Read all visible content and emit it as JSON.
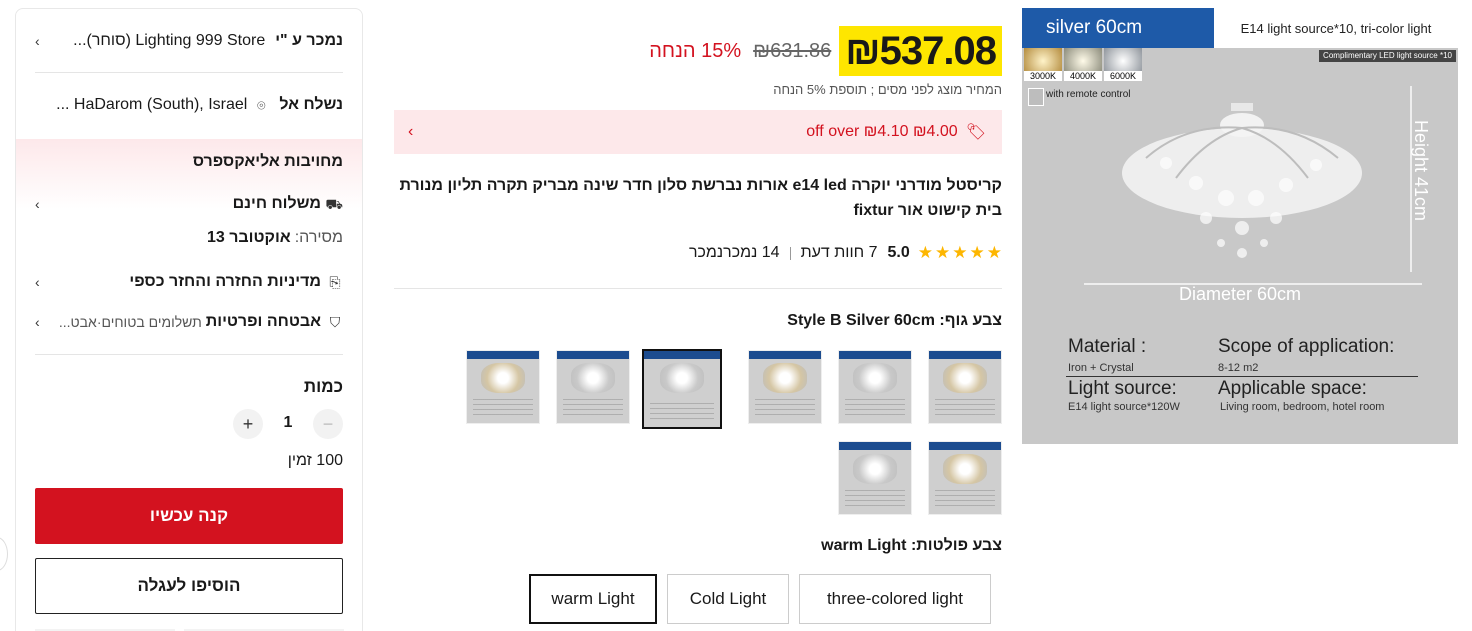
{
  "sidebar": {
    "sold_by_label": "נמכר ע \"י",
    "sold_by_store": "Lighting 999 Store (סוחר)...",
    "ship_to_label": "נשלח אל",
    "ship_to_value": "HaDarom (South), Israel ...",
    "commitment_title": "מחויבות אליאקספרס",
    "free_shipping": "משלוח חינם",
    "delivery_label": "מסירה:",
    "delivery_date": "אוקטובר 13",
    "returns": "מדיניות החזרה והחזר כספי",
    "security_label": "אבטחה ופרטיות",
    "security_detail": "תשלומים בטוחים·אבט...",
    "quantity_label": "כמות",
    "quantity_value": "1",
    "stock": "100 זמין",
    "buy_now": "קנה עכשיו",
    "add_to_cart": "הוסיפו לעגלה"
  },
  "price": {
    "current": "₪537.08",
    "original": "₪631.86",
    "discount": "15% הנחה",
    "tax_note": "המחיר מוצג לפני מסים ; תוספת 5% הנחה"
  },
  "coupon": {
    "text": "₪4.00 off over ₪4.10"
  },
  "product": {
    "title": "קריסטל מודרני יוקרה e14 led אורות נברשת סלון חדר שינה מבריק תקרה תליון מנורת בית קישוט אור fixtur",
    "rating": "5.0",
    "reviews": "7 חוות דעת",
    "sold": "14 נמכרנמכר"
  },
  "options": {
    "body_color_label": "צבע גוף:",
    "body_color_value": "Style B Silver 60cm",
    "bulb_color_label": "צבע פולטות:",
    "bulb_color_value": "warm Light",
    "bulb_choices": [
      "warm Light",
      "Cold Light",
      "three-colored light"
    ]
  },
  "image": {
    "header_left": "silver  60cm",
    "header_right": "E14 light source*10, tri-color light",
    "complimentary": "Complimentary LED light source *10",
    "temps": [
      "3000K",
      "4000K",
      "6000K"
    ],
    "remote": "with remote control",
    "height": "Height 41cm",
    "diameter": "Diameter 60cm",
    "material_k": "Material :",
    "material_v": "Iron + Crystal",
    "scope_k": "Scope of application:",
    "scope_v": "8-12 m2",
    "light_k": "Light source:",
    "light_v": "E14 light source*120W",
    "space_k": "Applicable space:",
    "space_v": "Living room, bedroom, hotel room"
  },
  "colors": {
    "accent": "#d3121f",
    "price_highlight": "#fee600",
    "star": "#fdb600",
    "image_blue": "#1e5aa8"
  }
}
